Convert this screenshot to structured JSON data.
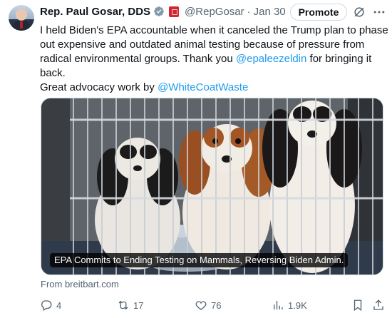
{
  "author": {
    "name": "Rep. Paul Gosar, DDS",
    "handle": "@RepGosar",
    "separator": "·",
    "date": "Jan 30"
  },
  "header": {
    "promote_label": "Promote"
  },
  "tweet": {
    "line1": "I held Biden's EPA accountable when it canceled the Trump plan to phase",
    "line2": "out expensive and outdated animal testing because of pressure from",
    "line3_pre": "radical environmental groups. Thank you ",
    "line3_mention": "@epaleezeldin",
    "line3_post": " for bringing it",
    "line4": "back.",
    "line5_pre": "Great advocacy work by ",
    "line5_mention": "@WhiteCoatWaste"
  },
  "media": {
    "caption": "EPA Commits to Ending Testing on Mammals, Reversing Biden Admin.",
    "source": "From breitbart.com"
  },
  "actions": {
    "replies": "4",
    "reposts": "17",
    "likes": "76",
    "views": "1.9K"
  },
  "icons": {
    "verified": "verified-badge-icon",
    "flag": "government-flag-icon",
    "grok": "grok-icon",
    "more": "more-icon",
    "reply": "reply-icon",
    "repost": "repost-icon",
    "like": "heart-icon",
    "views": "views-icon",
    "bookmark": "bookmark-icon",
    "share": "share-icon"
  },
  "colors": {
    "link": "#1d9bf0",
    "secondary_text": "#536471",
    "verified": "#829aab",
    "flag": "#d3242f"
  }
}
